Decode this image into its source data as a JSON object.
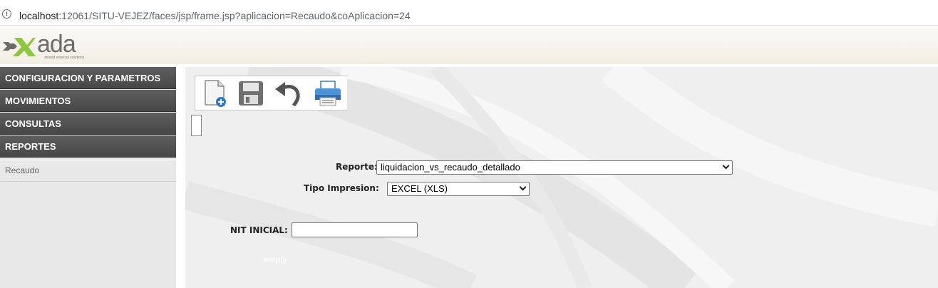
{
  "browser": {
    "url_host": "localhost",
    "url_rest": ":12061/SITU-VEJEZ/faces/jsp/frame.jsp?aplicacion=Recaudo&coAplicacion=24"
  },
  "logo": {
    "word": "ada",
    "tagline": "shared services solutions"
  },
  "sidebar": {
    "items": [
      {
        "label": "CONFIGURACION Y PARAMETROS"
      },
      {
        "label": "MOVIMIENTOS"
      },
      {
        "label": "CONSULTAS"
      },
      {
        "label": "REPORTES"
      }
    ],
    "subitem": "Recaudo"
  },
  "toolbar": {
    "buttons": [
      "new-document-icon",
      "save-icon",
      "undo-icon",
      "print-icon"
    ]
  },
  "form": {
    "reporte_label": "Reporte:",
    "reporte_value": "liquidacion_vs_recaudo_detallado",
    "tipo_label": "Tipo Impresion:",
    "tipo_value": "EXCEL (XLS)",
    "nit_label": "NIT INICIAL:",
    "nit_value": "",
    "empty_text": "empty"
  }
}
